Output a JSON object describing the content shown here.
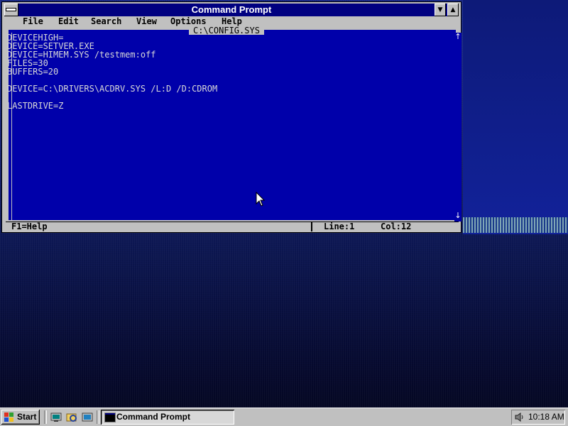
{
  "window": {
    "title": "Command Prompt",
    "document_title": "C:\\CONFIG.SYS"
  },
  "menu": {
    "items": [
      "File",
      "Edit",
      "Search",
      "View",
      "Options",
      "Help"
    ]
  },
  "editor": {
    "lines": [
      "DEVICEHIGH=",
      "DEVICE=SETVER.EXE",
      "DEVICE=HIMEM.SYS /testmem:off",
      "FILES=30",
      "BUFFERS=20",
      "",
      "DEVICE=C:\\DRIVERS\\ACDRV.SYS /L:D /D:CDROM",
      "",
      "LASTDRIVE=Z"
    ]
  },
  "statusbar": {
    "help": "F1=Help",
    "line": "Line:1",
    "col": "Col:12"
  },
  "taskbar": {
    "start_label": "Start",
    "task_label": "Command Prompt",
    "clock": "10:18 AM"
  },
  "icons": {
    "system_menu": "system-menu-icon",
    "minimize": "minimize-arrow-icon",
    "maximize": "maximize-arrow-icon",
    "scroll_up": "scroll-up-arrow-icon",
    "scroll_down": "scroll-down-arrow-icon",
    "cursor": "mouse-pointer-icon",
    "start_logo": "windows-logo-icon",
    "quick_launch": [
      "desktop-icon",
      "explorer-icon",
      "browser-icon"
    ],
    "tray": "speaker-icon"
  },
  "colors": {
    "title_bar": "#000080",
    "editor_bg": "#0000aa",
    "editor_text": "#d8d8d8",
    "chrome": "#c0c0c0"
  }
}
